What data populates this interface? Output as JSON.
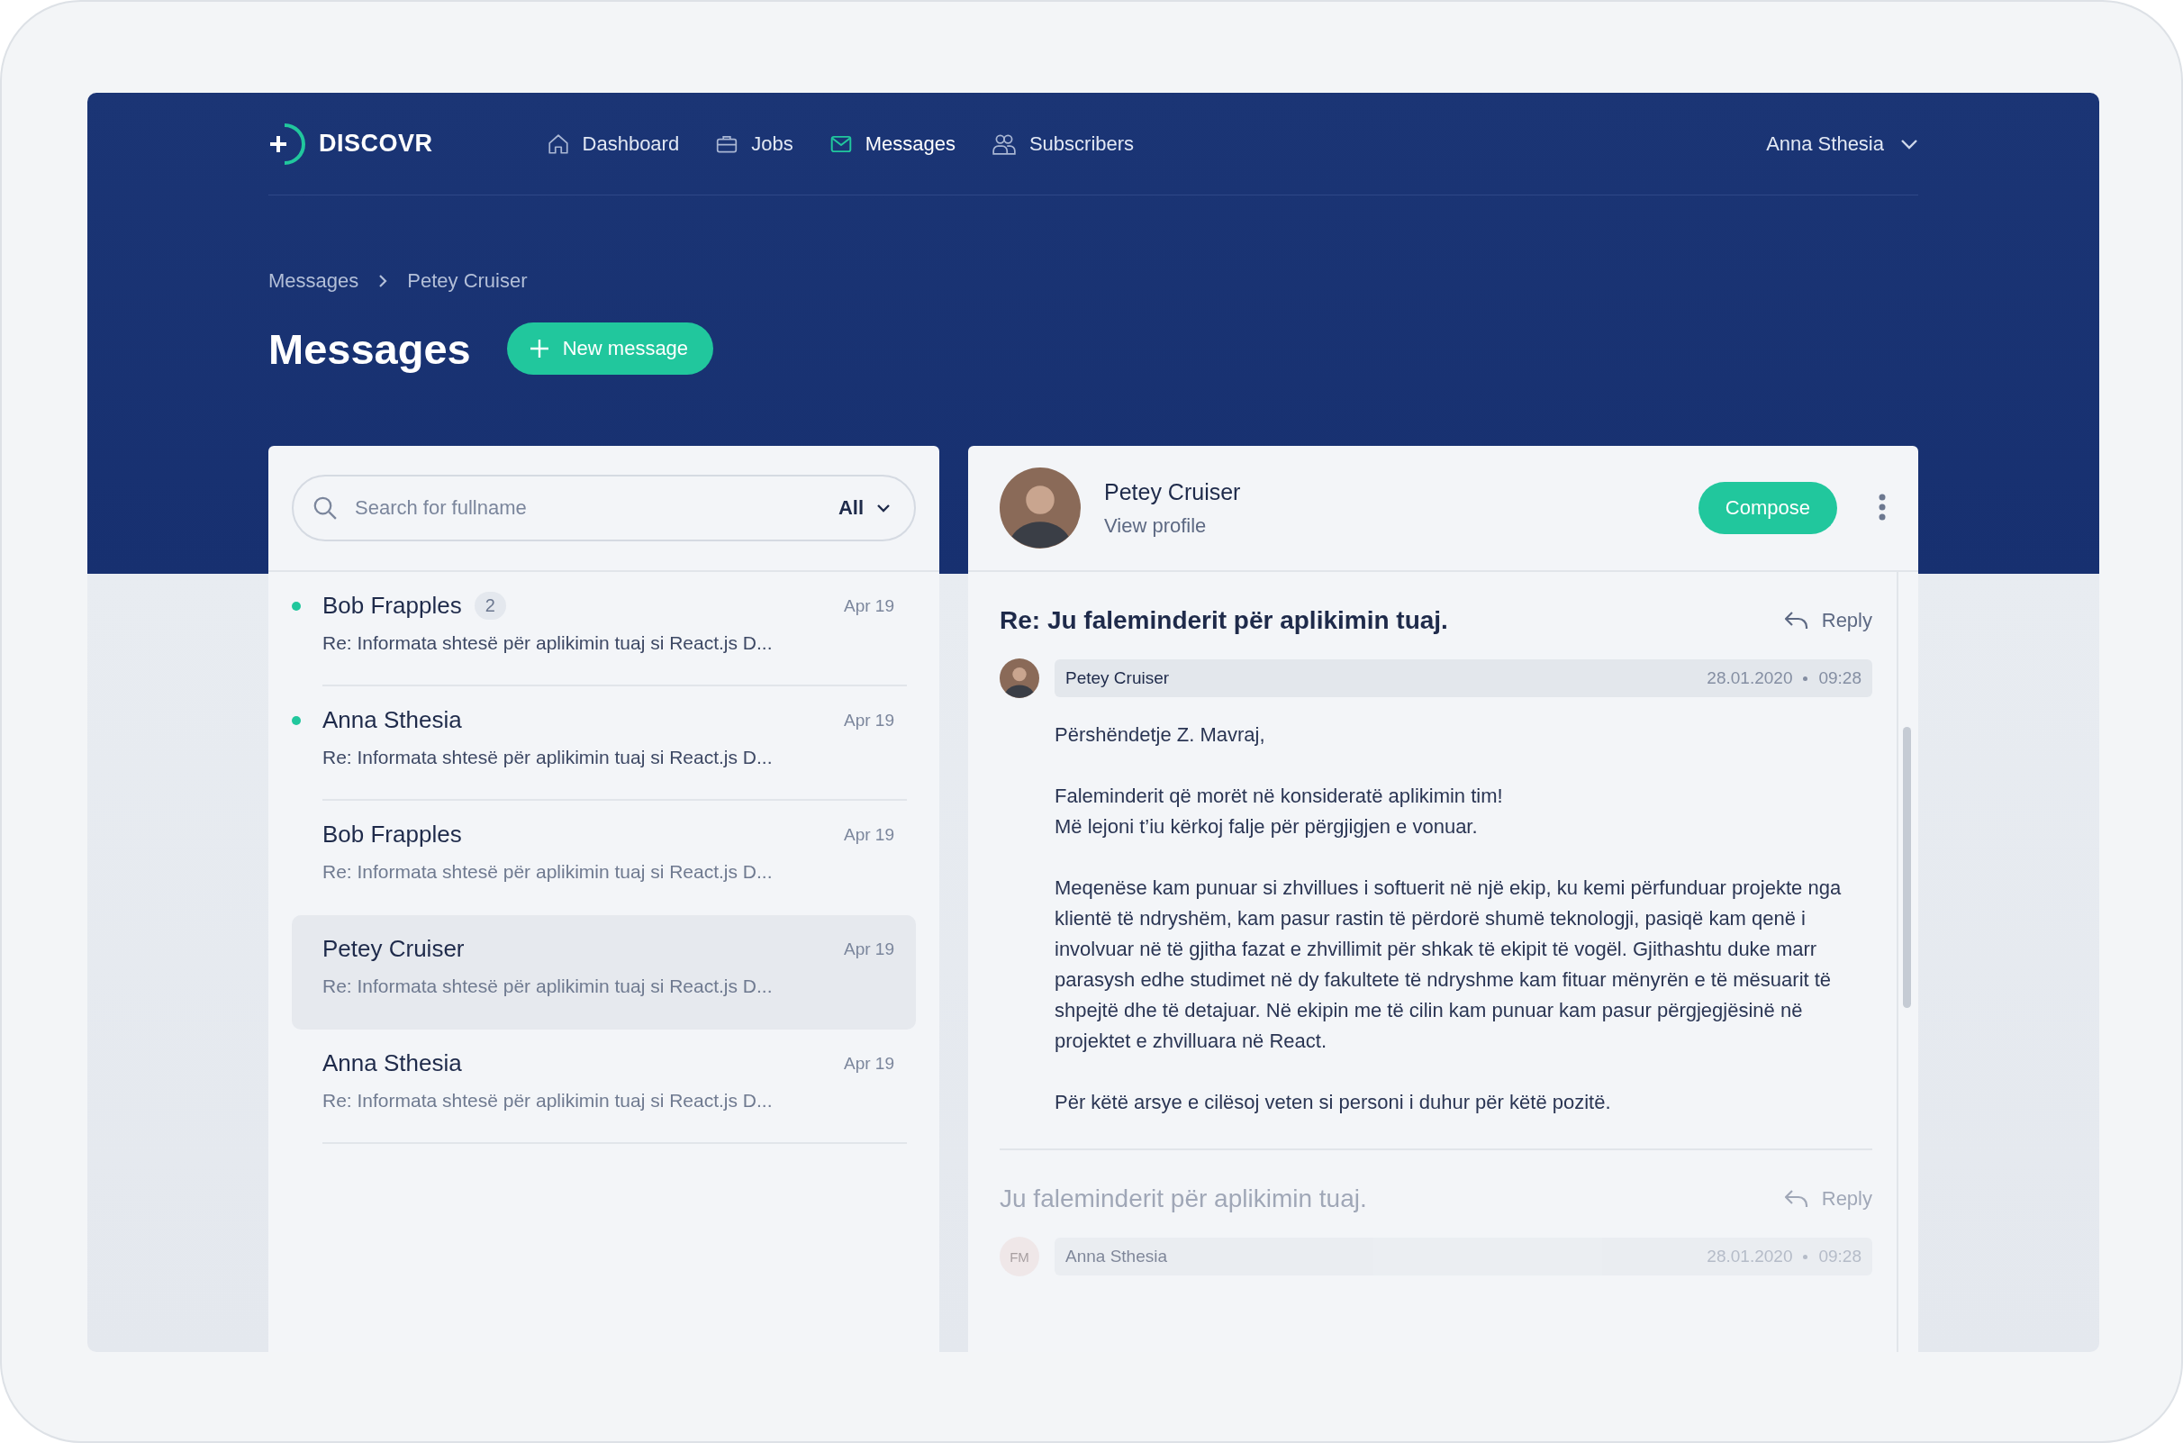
{
  "brand": {
    "name": "DISCOVR"
  },
  "nav": [
    {
      "label": "Dashboard",
      "kind": "home",
      "selected": false
    },
    {
      "label": "Jobs",
      "kind": "briefcase",
      "selected": false
    },
    {
      "label": "Messages",
      "kind": "envelope",
      "selected": true
    },
    {
      "label": "Subscribers",
      "kind": "people",
      "selected": false
    }
  ],
  "user_menu": {
    "name": "Anna Sthesia"
  },
  "breadcrumb": [
    "Messages",
    "Petey Cruiser"
  ],
  "page_title": "Messages",
  "new_button": {
    "label": "New message"
  },
  "search": {
    "placeholder": "Search for fullname",
    "filter": "All"
  },
  "conversations": [
    {
      "name": "Bob Frapples",
      "badge": "2",
      "date": "Apr 19",
      "preview": "Re: Informata shtesë për aplikimin tuaj si React.js D...",
      "unread": true,
      "selected": false
    },
    {
      "name": "Anna Sthesia",
      "date": "Apr 19",
      "preview": "Re: Informata shtesë për aplikimin tuaj si React.js D...",
      "unread": true,
      "selected": false
    },
    {
      "name": "Bob Frapples",
      "date": "Apr 19",
      "preview": "Re: Informata shtesë për aplikimin tuaj si React.js D...",
      "unread": false,
      "selected": false
    },
    {
      "name": "Petey Cruiser",
      "date": "Apr 19",
      "preview": "Re: Informata shtesë për aplikimin tuaj si React.js D...",
      "unread": false,
      "selected": true
    },
    {
      "name": "Anna Sthesia",
      "date": "Apr 19",
      "preview": "Re: Informata shtesë për aplikimin tuaj si React.js D...",
      "unread": false,
      "selected": false
    }
  ],
  "thread_header": {
    "name": "Petey Cruiser",
    "link": "View profile",
    "compose": "Compose"
  },
  "messages": [
    {
      "subject": "Re: Ju faleminderit për aplikimin tuaj.",
      "reply": "Reply",
      "sender": "Petey Cruiser",
      "avatar": {
        "kind": "photo"
      },
      "date": "28.01.2020",
      "time": "09:28",
      "faded": false,
      "paragraphs": [
        [
          "Përshëndetje Z. Mavraj,"
        ],
        [
          "Faleminderit që morët në konsideratë aplikimin tim!",
          "Më lejoni t’iu kërkoj falje për përgjigjen e vonuar."
        ],
        [
          "Meqenëse kam punuar si zhvillues i softuerit në një ekip, ku kemi përfunduar projekte nga klientë të ndryshëm, kam pasur rastin të përdorë shumë teknologji, pasiqë kam qenë i involvuar në të gjitha fazat e zhvillimit për shkak të ekipit të vogël. Gjithashtu duke marr parasysh edhe studimet në dy fakultete të ndryshme kam fituar mënyrën e të mësuarit të shpejtë dhe të detajuar. Në ekipin me të cilin kam punuar kam pasur përgjegjësinë në projektet e zhvilluara në React."
        ],
        [
          "Për këtë arsye e cilësoj veten si personi i duhur për këtë pozitë."
        ]
      ]
    },
    {
      "subject": "Ju faleminderit për aplikimin tuaj.",
      "reply": "Reply",
      "sender": "Anna Sthesia",
      "avatar": {
        "kind": "initials",
        "initials": "FM"
      },
      "date": "28.01.2020",
      "time": "09:28",
      "faded": true
    }
  ]
}
